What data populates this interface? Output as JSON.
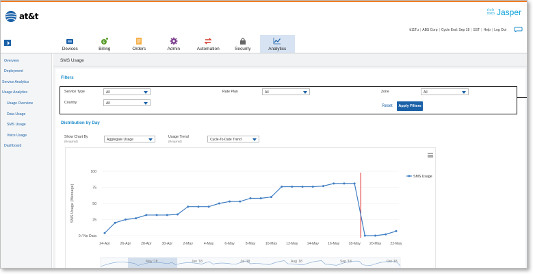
{
  "header": {
    "logo_text": "at&t",
    "brand_small": "cisco",
    "brand": "Jasper",
    "user": "tt11Tu",
    "company": "ABS Corp",
    "cycle": "Cycle End: Sep 18",
    "timezone": "SST",
    "help": "Help",
    "logout": "Log Out"
  },
  "nav": [
    {
      "label": "Devices",
      "icon": "devices-icon",
      "color": "#1b61a8"
    },
    {
      "label": "Billing",
      "icon": "billing-icon",
      "color": "#5a9e2c"
    },
    {
      "label": "Orders",
      "icon": "orders-icon",
      "color": "#e8921c"
    },
    {
      "label": "Admin",
      "icon": "admin-icon",
      "color": "#7a3c8c"
    },
    {
      "label": "Automation",
      "icon": "automation-icon",
      "color": "#d33b2c"
    },
    {
      "label": "Security",
      "icon": "security-icon",
      "color": "#666666"
    },
    {
      "label": "Analytics",
      "icon": "analytics-icon",
      "color": "#1b61a8",
      "active": true
    }
  ],
  "sidebar": [
    {
      "label": "Overview"
    },
    {
      "label": "Deployment"
    },
    {
      "label": "Service Analytics"
    },
    {
      "label": "Usage Analytics"
    },
    {
      "label": "Usage Overview"
    },
    {
      "label": "Data Usage"
    },
    {
      "label": "SMS Usage",
      "active": true
    },
    {
      "label": "Voice Usage"
    },
    {
      "label": "Dashboard"
    }
  ],
  "page": {
    "title": "SMS Usage",
    "filters_title": "Filters",
    "distribution_title": "Distribution by Day"
  },
  "filters": {
    "service_type": {
      "label": "Service Type",
      "value": "All"
    },
    "rate_plan": {
      "label": "Rate Plan",
      "value": "All"
    },
    "zone": {
      "label": "Zone",
      "value": "All"
    },
    "country": {
      "label": "Country",
      "value": "All"
    },
    "reset": "Reset",
    "apply": "Apply Filters"
  },
  "chart_controls": {
    "show_by": {
      "label": "Show Chart By",
      "required": "(Required)",
      "value": "Aggregate Usage"
    },
    "usage_trend": {
      "label": "Usage Trend",
      "required": "(Required)",
      "value": "Cycle-To-Date Trend"
    }
  },
  "chart_data": {
    "type": "line",
    "title": "",
    "xlabel": "",
    "ylabel": "SMS Usage (Message)",
    "ylim": [
      0,
      100
    ],
    "yticks": [
      "0 / No Data",
      "25",
      "50",
      "75",
      "100"
    ],
    "xtick_labels": [
      "24-Apr",
      "26-Apr",
      "28-Apr",
      "30-Apr",
      "2-May",
      "4-May",
      "6-May",
      "8-May",
      "10-May",
      "12-May",
      "14-May",
      "16-May",
      "18-May",
      "20-May",
      "22-May"
    ],
    "grid": "horizontal",
    "legend": "top-right",
    "series": [
      {
        "name": "SMS Usage",
        "color": "#3f7ec3",
        "values": [
          4,
          20,
          25,
          27,
          32,
          32,
          32,
          33,
          45,
          45,
          45,
          50,
          53,
          53,
          58,
          58,
          60,
          76,
          76,
          76,
          76,
          77,
          81,
          81,
          81,
          0,
          0,
          2,
          7
        ]
      }
    ],
    "marker_line": {
      "x_index": 24.6,
      "color": "#e02020"
    },
    "navigator_labels": [
      "May '18",
      "Jun '18",
      "Jul '18",
      "Aug '18",
      "Sep '18",
      "Oct '18"
    ]
  }
}
